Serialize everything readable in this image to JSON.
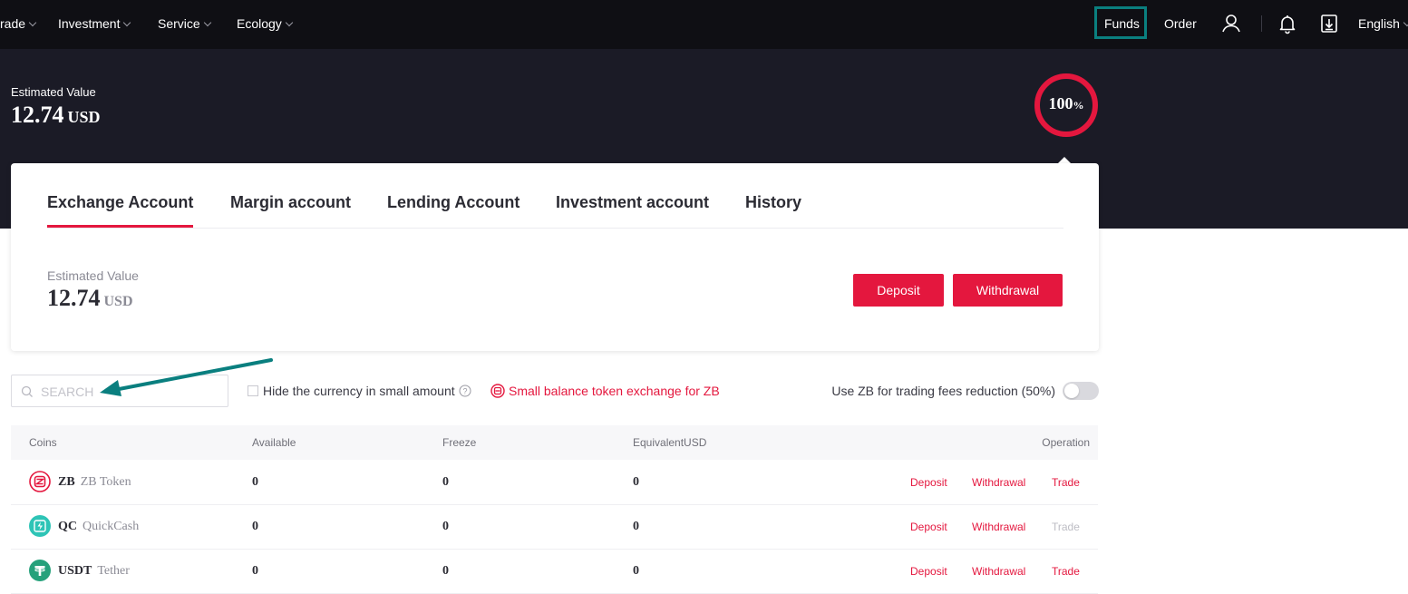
{
  "nav": {
    "items": [
      {
        "label": "rade"
      },
      {
        "label": "Investment"
      },
      {
        "label": "Service"
      },
      {
        "label": "Ecology"
      }
    ],
    "funds": "Funds",
    "order": "Order",
    "language": "English"
  },
  "hero": {
    "label": "Estimated Value",
    "value": "12.74",
    "unit": "USD",
    "ratio_value": "100",
    "ratio_unit": "%"
  },
  "tabs": [
    {
      "label": "Exchange Account",
      "active": true
    },
    {
      "label": "Margin account"
    },
    {
      "label": "Lending Account"
    },
    {
      "label": "Investment account"
    },
    {
      "label": "History"
    }
  ],
  "account": {
    "label": "Estimated Value",
    "value": "12.74",
    "unit": "USD",
    "deposit": "Deposit",
    "withdrawal": "Withdrawal"
  },
  "filters": {
    "search_placeholder": "SEARCH",
    "hide_small": "Hide the currency in small amount",
    "small_balance_link": "Small balance token exchange for ZB",
    "fee_reduction": "Use ZB for trading fees reduction (50%)",
    "fee_reduction_on": false
  },
  "table": {
    "headers": [
      "Coins",
      "Available",
      "Freeze",
      "EquivalentUSD",
      "Operation"
    ],
    "rows": [
      {
        "symbol": "ZB",
        "name": "ZB Token",
        "available": "0",
        "freeze": "0",
        "usd": "0",
        "ops": {
          "deposit": "Deposit",
          "withdrawal": "Withdrawal",
          "trade": "Trade"
        },
        "trade_enabled": true,
        "icon": "zb-token-icon"
      },
      {
        "symbol": "QC",
        "name": "QuickCash",
        "available": "0",
        "freeze": "0",
        "usd": "0",
        "ops": {
          "deposit": "Deposit",
          "withdrawal": "Withdrawal",
          "trade": "Trade"
        },
        "trade_enabled": false,
        "icon": "quickcash-icon"
      },
      {
        "symbol": "USDT",
        "name": "Tether",
        "available": "0",
        "freeze": "0",
        "usd": "0",
        "ops": {
          "deposit": "Deposit",
          "withdrawal": "Withdrawal",
          "trade": "Trade"
        },
        "trade_enabled": true,
        "icon": "tether-icon"
      }
    ]
  },
  "colors": {
    "accent": "#e4173e",
    "nav_bg": "#0f0f14",
    "hero_bg": "#1b1b26",
    "highlight_box": "#0a7f7f",
    "annotation_arrow": "#0a7f7f",
    "disabled_text": "#bdbdc4"
  }
}
